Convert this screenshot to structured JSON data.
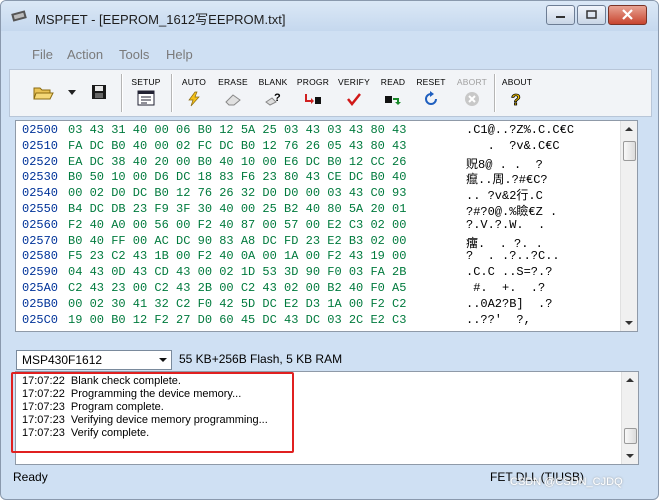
{
  "window": {
    "title": "MSPFET - [EEPROM_1612写EEPROM.txt]"
  },
  "menu": [
    "File",
    "Action",
    "Tools",
    "Help"
  ],
  "toolbar": {
    "setup": "SETUP",
    "auto": "AUTO",
    "erase": "ERASE",
    "blank": "BLANK",
    "program": "PROGR",
    "verify": "VERIFY",
    "read": "READ",
    "reset": "RESET",
    "abort": "ABORT",
    "about": "ABOUT"
  },
  "hex_rows": [
    {
      "addr": "02500",
      "bytes": "03 43 31 40 00 06 B0 12 5A 25 03 43 03 43 80 43",
      "ascii": ".C1@..?Z%.C.C€C"
    },
    {
      "addr": "02510",
      "bytes": "FA DC B0 40 00 02 FC DC B0 12 76 26 05 43 80 43",
      "ascii": "   .  ?v&.C€C"
    },
    {
      "addr": "02520",
      "bytes": "EA DC 38 40 20 00 B0 40 10 00 E6 DC B0 12 CC 26",
      "ascii": "贶8@ . .  ?"
    },
    {
      "addr": "02530",
      "bytes": "B0 50 10 00 D6 DC 18 83 F6 23 80 43 CE DC B0 40",
      "ascii": "癙..周.?#€C?"
    },
    {
      "addr": "02540",
      "bytes": "00 02 D0 DC B0 12 76 26 32 D0 D0 00 03 43 C0 93",
      "ascii": ".. ?v&2行.C"
    },
    {
      "addr": "02550",
      "bytes": "B4 DC DB 23 F9 3F 30 40 00 25 B2 40 80 5A 20 01",
      "ascii": "?#?0@.%瞼€Z ."
    },
    {
      "addr": "02560",
      "bytes": "F2 40 A0 00 56 00 F2 40 87 00 57 00 E2 C3 02 00",
      "ascii": "?.V.?.W.  ."
    },
    {
      "addr": "02570",
      "bytes": "B0 40 FF 00 AC DC 90 83 A8 DC FD 23 E2 B3 02 00",
      "ascii": "癅.  . ?. ."
    },
    {
      "addr": "02580",
      "bytes": "F5 23 C2 43 1B 00 F2 40 0A 00 1A 00 F2 43 19 00",
      "ascii": "?  . .?..?C.."
    },
    {
      "addr": "02590",
      "bytes": "04 43 0D 43 CD 43 00 02 1D 53 3D 90 F0 03 FA 2B",
      "ascii": ".C.C ..S=?.?"
    },
    {
      "addr": "025A0",
      "bytes": "C2 43 23 00 C2 43 2B 00 C2 43 02 00 B2 40 F0 A5",
      "ascii": " #.  +.  .?"
    },
    {
      "addr": "025B0",
      "bytes": "00 02 30 41 32 C2 F0 42 5D DC E2 D3 1A 00 F2 C2",
      "ascii": "..0A2?B]  .?"
    },
    {
      "addr": "025C0",
      "bytes": "19 00 B0 12 F2 27 D0 60 45 DC 43 DC 03 2C E2 C3",
      "ascii": "..??'  ?,  "
    }
  ],
  "device": {
    "selected": "MSP430F1612",
    "info": "55 KB+256B Flash, 5 KB RAM"
  },
  "log": [
    "17:07:22  Blank check complete.",
    "17:07:22  Programming the device memory...",
    "17:07:23  Program complete.",
    "17:07:23  Verifying device memory programming...",
    "17:07:23  Verify complete."
  ],
  "status": {
    "left": "Ready",
    "right": "FET DLL (TIUSB)"
  },
  "watermark": "CSDN @CSDN_CJDQ",
  "colors": {
    "hex_address": "#003399",
    "hex_bytes": "#007a3d",
    "highlight_box": "#e02020"
  }
}
